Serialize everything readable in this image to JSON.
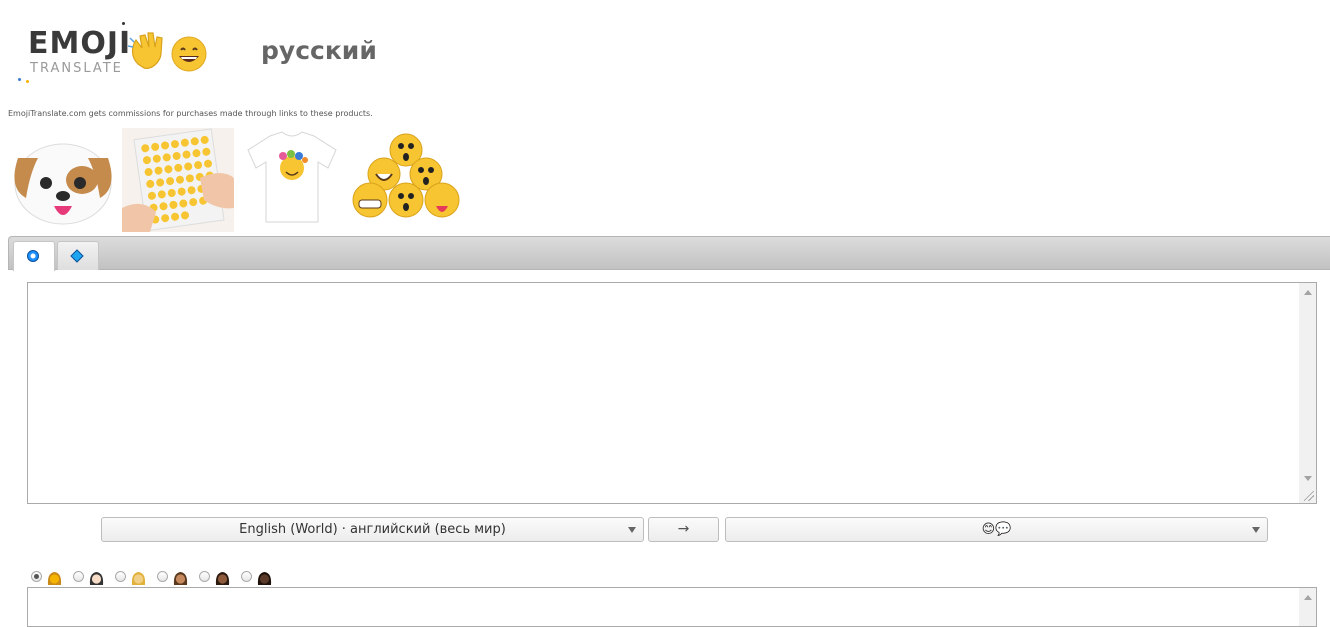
{
  "header": {
    "logo_word": "EMOJI",
    "logo_sub": "TRANSLATE",
    "language_title": "русский"
  },
  "disclosure": "EmojiTranslate.com gets commissions for purchases made through links to these products.",
  "products": [
    {
      "name": "dog-emoji-pillow"
    },
    {
      "name": "emoji-sticker-sheet"
    },
    {
      "name": "emoji-t-shirt"
    },
    {
      "name": "emoji-plush-pyramid"
    }
  ],
  "tabs": [
    {
      "icon": "blue-ring-icon",
      "selected": true
    },
    {
      "icon": "blue-diamond-icon",
      "selected": false
    }
  ],
  "input": {
    "value": ""
  },
  "controls": {
    "source_language": "English (World) · английский (весь мир)",
    "swap_label": "→",
    "target_language": "😊💬"
  },
  "skin_tones": [
    {
      "color": "#f4b400",
      "hair": "#c98a1a",
      "selected": true
    },
    {
      "color": "#f7dcc8",
      "hair": "#333333",
      "selected": false
    },
    {
      "color": "#f1cf87",
      "hair": "#e0b23b",
      "selected": false
    },
    {
      "color": "#c68a5e",
      "hair": "#5a3a1e",
      "selected": false
    },
    {
      "color": "#8d5a3b",
      "hair": "#2b1a10",
      "selected": false
    },
    {
      "color": "#5b3a2a",
      "hair": "#1e120b",
      "selected": false
    }
  ],
  "output": {
    "value": ""
  },
  "colors": {
    "accent": "#1e90ff",
    "emoji_yellow": "#f7c531"
  }
}
